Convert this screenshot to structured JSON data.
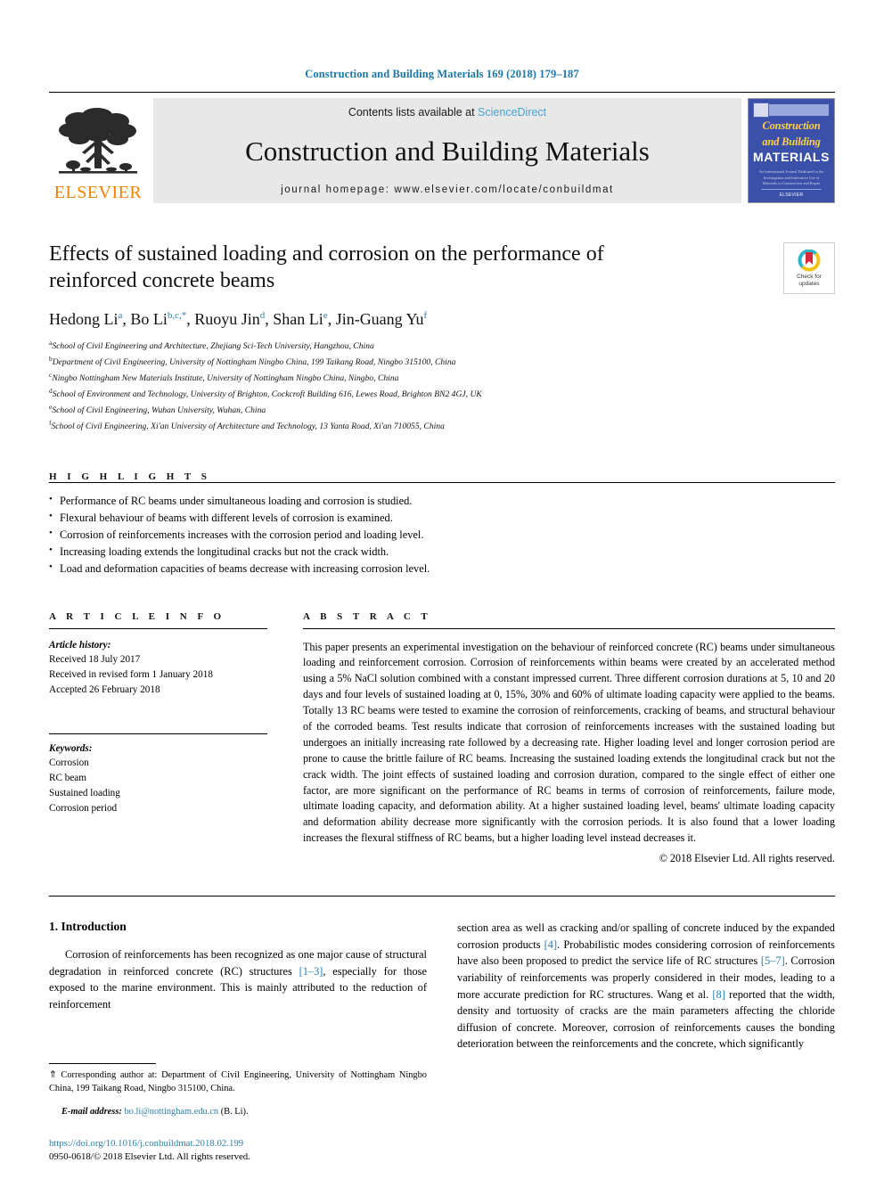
{
  "running_head": "Construction and Building Materials 169 (2018) 179–187",
  "masthead": {
    "publisher": "ELSEVIER",
    "contents_prefix": "Contents lists available at ",
    "contents_link": "ScienceDirect",
    "journal_title": "Construction and Building Materials",
    "homepage": "journal homepage: www.elsevier.com/locate/conbuildmat",
    "cover": {
      "line1": "Construction",
      "line2": "and Building",
      "line3": "MATERIALS",
      "subtitle": "An International Journal Dedicated to the Investigation and Innovative Use of Materials in Construction and Repair",
      "footer": "ELSEVIER"
    }
  },
  "article": {
    "title": "Effects of sustained loading and corrosion on the performance of reinforced concrete beams",
    "authors_plain": "Hedong Li a, Bo Li b,c,*, Ruoyu Jin d, Shan Li e, Jin-Guang Yu f",
    "crossmark_label": "Check for\nupdates",
    "crossmark_line1": "Check for",
    "crossmark_line2": "updates",
    "affiliations": [
      {
        "mark": "a",
        "text": "School of Civil Engineering and Architecture, Zhejiang Sci-Tech University, Hangzhou, China"
      },
      {
        "mark": "b",
        "text": "Department of Civil Engineering, University of Nottingham Ningbo China, 199 Taikang Road, Ningbo 315100, China"
      },
      {
        "mark": "c",
        "text": "Ningbo Nottingham New Materials Institute, University of Nottingham Ningbo China, Ningbo, China"
      },
      {
        "mark": "d",
        "text": "School of Environment and Technology, University of Brighton, Cockcroft Building 616, Lewes Road, Brighton BN2 4GJ, UK"
      },
      {
        "mark": "e",
        "text": "School of Civil Engineering, Wuhan University, Wuhan, China"
      },
      {
        "mark": "f",
        "text": "School of Civil Engineering, Xi'an University of Architecture and Technology, 13 Yanta Road, Xi'an 710055, China"
      }
    ]
  },
  "highlights": {
    "heading": "H I G H L I G H T S",
    "items": [
      "Performance of RC beams under simultaneous loading and corrosion is studied.",
      "Flexural behaviour of beams with different levels of corrosion is examined.",
      "Corrosion of reinforcements increases with the corrosion period and loading level.",
      "Increasing loading extends the longitudinal cracks but not the crack width.",
      "Load and deformation capacities of beams decrease with increasing corrosion level."
    ]
  },
  "article_info": {
    "heading": "A R T I C L E    I N F O",
    "history_label": "Article history:",
    "history": [
      "Received 18 July 2017",
      "Received in revised form 1 January 2018",
      "Accepted 26 February 2018"
    ],
    "keywords_label": "Keywords:",
    "keywords": [
      "Corrosion",
      "RC beam",
      "Sustained loading",
      "Corrosion period"
    ]
  },
  "abstract": {
    "heading": "A B S T R A C T",
    "text": "This paper presents an experimental investigation on the behaviour of reinforced concrete (RC) beams under simultaneous loading and reinforcement corrosion. Corrosion of reinforcements within beams were created by an accelerated method using a 5% NaCl solution combined with a constant impressed current. Three different corrosion durations at 5, 10 and 20 days and four levels of sustained loading at 0, 15%, 30% and 60% of ultimate loading capacity were applied to the beams. Totally 13 RC beams were tested to examine the corrosion of reinforcements, cracking of beams, and structural behaviour of the corroded beams. Test results indicate that corrosion of reinforcements increases with the sustained loading but undergoes an initially increasing rate followed by a decreasing rate. Higher loading level and longer corrosion period are prone to cause the brittle failure of RC beams. Increasing the sustained loading extends the longitudinal crack but not the crack width. The joint effects of sustained loading and corrosion duration, compared to the single effect of either one factor, are more significant on the performance of RC beams in terms of corrosion of reinforcements, failure mode, ultimate loading capacity, and deformation ability. At a higher sustained loading level, beams' ultimate loading capacity and deformation ability decrease more significantly with the corrosion periods. It is also found that a lower loading increases the flexural stiffness of RC beams, but a higher loading level instead decreases it.",
    "copyright": "© 2018 Elsevier Ltd. All rights reserved."
  },
  "introduction": {
    "heading": "1. Introduction",
    "left_paragraph_1": "Corrosion of reinforcements has been recognized as one major cause of structural degradation in reinforced concrete (RC) structures ",
    "left_ref_1": "[1–3]",
    "left_paragraph_1b": ", especially for those exposed to the marine environment. This is mainly attributed to the reduction of reinforcement",
    "right_parts": {
      "p1": "section area as well as cracking and/or spalling of concrete induced by the expanded corrosion products ",
      "ref1": "[4]",
      "p2": ". Probabilistic modes considering corrosion of reinforcements have also been proposed to predict the service life of RC structures ",
      "ref2": "[5–7]",
      "p3": ". Corrosion variability of reinforcements was properly considered in their modes, leading to a more accurate prediction for RC structures. Wang et al. ",
      "ref3": "[8]",
      "p4": " reported that the width, density and tortuosity of cracks are the main parameters affecting the chloride diffusion of concrete. Moreover, corrosion of reinforcements causes the bonding deterioration between the reinforcements and the concrete, which significantly"
    }
  },
  "footnote": {
    "star": "⇑",
    "corresponding": " Corresponding author at: Department of Civil Engineering, University of Nottingham Ningbo China, 199 Taikang Road, Ningbo 315100, China.",
    "email_label": "E-mail address:",
    "email": "bo.li@nottingham.edu.cn",
    "email_suffix": " (B. Li).",
    "doi": "https://doi.org/10.1016/j.conbuildmat.2018.02.199",
    "issn_line": "0950-0618/© 2018 Elsevier Ltd. All rights reserved."
  },
  "colors": {
    "link": "#2b7fa8",
    "running_head": "#1c76a8",
    "elsevier_orange": "#ef8200",
    "cover_blue": "#3b50a8",
    "band_gray": "#e8e8e8"
  }
}
